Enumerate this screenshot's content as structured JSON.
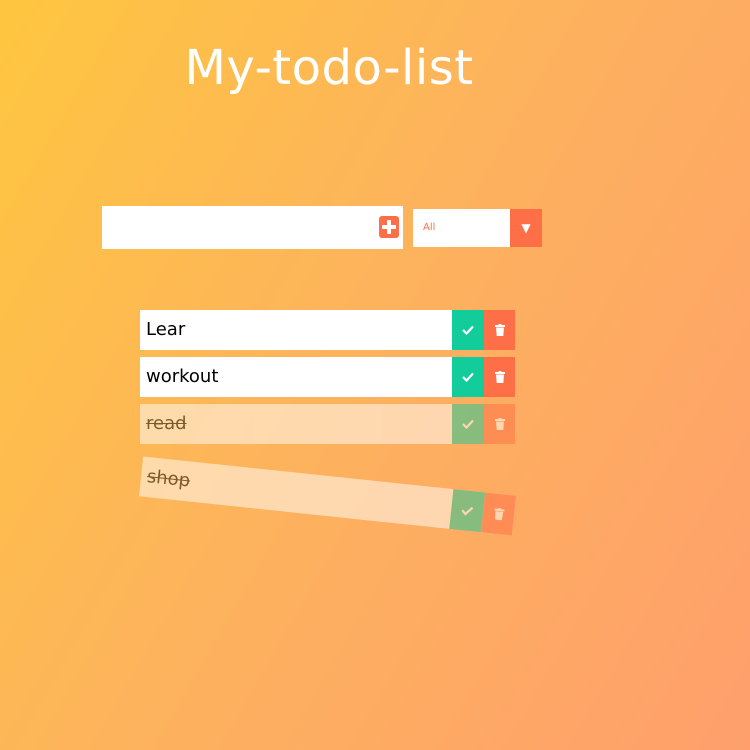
{
  "header": {
    "title": "My-todo-list"
  },
  "form": {
    "input_value": "",
    "add_icon": "plus-icon",
    "filter": {
      "selected": "All",
      "arrow_icon": "caret-down-icon"
    }
  },
  "todos": [
    {
      "text": "Lear",
      "completed": false
    },
    {
      "text": "workout",
      "completed": false
    },
    {
      "text": "read",
      "completed": true
    },
    {
      "text": "shop",
      "completed": true
    }
  ],
  "colors": {
    "accent": "#ff6f47",
    "check": "#13cc9c",
    "background_start": "#fec63f",
    "background_end": "#fe9f6c"
  },
  "icons": {
    "complete": "check-icon",
    "delete": "trash-icon"
  }
}
